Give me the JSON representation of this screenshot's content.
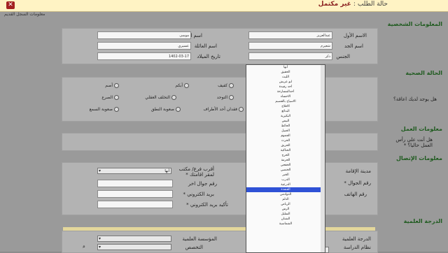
{
  "status_bar": {
    "label": "حالة الطلب :",
    "value": "غير مكتمل",
    "close_icon": "close-icon"
  },
  "old_record_link": "معلومات السجل القديم",
  "sections": {
    "personal": "المعلومات الشخصية",
    "health": "الحالة الصحية",
    "work": "معلومات العمل",
    "contact": "معلومات الإتصال",
    "degree": "الدرجة العلمية"
  },
  "personal": {
    "first_name_label": "الاسم الأول",
    "first_name_value": "عبدالعزيز",
    "father_label": "اسم الأب",
    "father_value": "موسى",
    "grandfather_label": "اسم الجد",
    "grandfather_value": "شعيرم",
    "family_label": "اسم العائلة",
    "family_value": "عسيري",
    "gender_label": "الجنس",
    "gender_value": "ذكر",
    "birth_label": "تاريخ الميلاد",
    "birth_value": "1402-03-17"
  },
  "health": {
    "question": "هل يوجد لديك اعاقة؟",
    "options": [
      "كفيف",
      "أبكم",
      "أصم",
      "التوحد",
      "التخلف العقلي",
      "الصرع",
      "فقدان أحد الأطراف",
      "صعوبة النطق",
      "صعوبة السمع"
    ]
  },
  "work": {
    "question": "هل أنت على رأس العمل حاليا؟ *"
  },
  "contact": {
    "residence_city_label": "مدينة الإقامة",
    "mobile_label": "رقم الجوال *",
    "phone_label": "رقم الهاتف",
    "nearest_branch_label": "أقرب فرع/ مكتب لمقر اقامتك *",
    "nearest_branch_value": "أبها",
    "other_mobile_label": "رقم جوال اخر",
    "email_label": "بريد الكتروني *",
    "email_confirm_label": "تأكيد بريد الكتروني *"
  },
  "degree": {
    "degree_label": "الدرجة العلمية",
    "study_system_label": "نظام الدراسة",
    "institution_label": "المؤسسة العلمية",
    "specialty_label": "التخصص"
  },
  "city_dropdown": {
    "options": [
      "أبها",
      "الخفيق",
      "الليث",
      "ابو عريش",
      "أحد رفيدة",
      "أحدالمسارحة",
      "الاحساء",
      "الاسياح بالقصيم",
      "الافلاج",
      "البدائع",
      "البكيرية",
      "البيض",
      "الحائط",
      "الجبيل",
      "الجموم",
      "الحرث",
      "الحريق",
      "الحناكية",
      "الخرج",
      "الخرمة",
      "الخفجي",
      "الخنصي",
      "الخبر",
      "الدرب",
      "الدرعية",
      "القنفذة",
      "الدوادمي",
      "الدلم",
      "الرياض",
      "الرس",
      "السليل",
      "الشنان",
      "الشماسية"
    ],
    "selected": "القنفذة"
  },
  "colors": {
    "section_green": "#1f5b1f",
    "status_red": "#8a1f1f",
    "highlight_blue": "#2f52d6"
  }
}
